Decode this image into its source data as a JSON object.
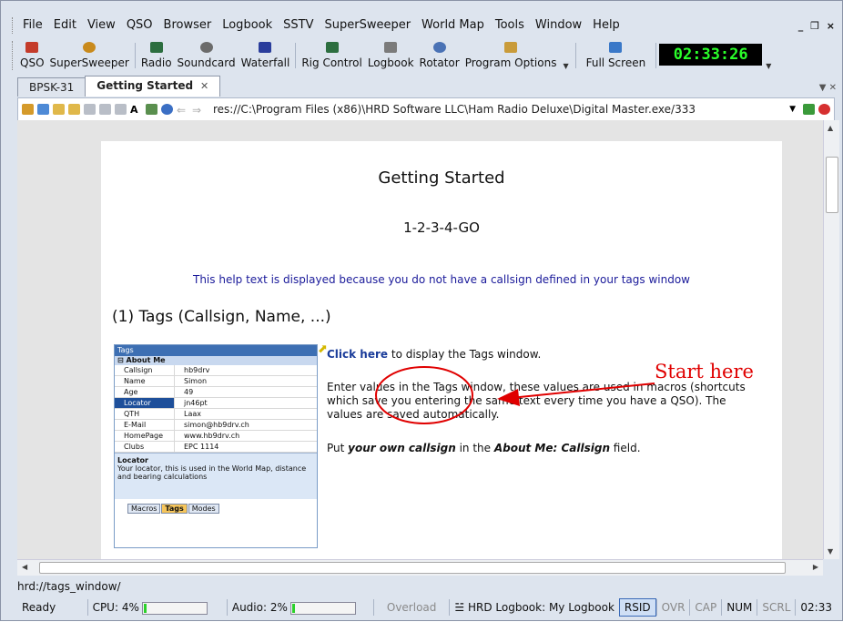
{
  "menu": [
    "File",
    "Edit",
    "View",
    "QSO",
    "Browser",
    "Logbook",
    "SSTV",
    "SuperSweeper",
    "World Map",
    "Tools",
    "Window",
    "Help"
  ],
  "window_controls": "_ ❒ ×",
  "toolbar": {
    "buttons": [
      {
        "label": "QSO",
        "icon": "qso-icon",
        "color": "#c43b2a"
      },
      {
        "label": "SuperSweeper",
        "icon": "supersweeper-icon",
        "color": "#c98a1c"
      },
      {
        "label": "Radio",
        "icon": "radio-icon",
        "color": "#2c6e3f"
      },
      {
        "label": "Soundcard",
        "icon": "soundcard-icon",
        "color": "#6b6b6b"
      },
      {
        "label": "Waterfall",
        "icon": "waterfall-icon",
        "color": "#2a3d9c"
      },
      {
        "label": "Rig Control",
        "icon": "rig-control-icon",
        "color": "#2c6e3f"
      },
      {
        "label": "Logbook",
        "icon": "logbook-icon",
        "color": "#7b7b7b"
      },
      {
        "label": "Rotator",
        "icon": "rotator-icon",
        "color": "#4a72b5"
      },
      {
        "label": "Program Options",
        "icon": "program-options-icon",
        "color": "#c99b3a"
      }
    ],
    "full_screen": "Full Screen",
    "clock": "02:33:26"
  },
  "tabs": [
    {
      "label": "BPSK-31",
      "active": false
    },
    {
      "label": "Getting Started",
      "active": true
    }
  ],
  "address": "res://C:\\Program Files (x86)\\HRD Software LLC\\Ham Radio Deluxe\\Digital Master.exe/333",
  "page": {
    "title": "Getting Started",
    "subtitle": "1-2-3-4-GO",
    "note": "This help text is displayed because you do not have a callsign defined in your tags window",
    "section": "(1) Tags (Callsign, Name, ...)",
    "click_here": "Click here",
    "click_rest": " to display the Tags window.",
    "para2": "Enter values in the Tags window, these values are used in macros (shortcuts which save you entering the same text every time you have a QSO). The values are saved automatically.",
    "para3_a": "Put ",
    "para3_b": "your own callsign",
    "para3_c": " in the ",
    "para3_d": "About Me: Callsign",
    "para3_e": " field."
  },
  "tags_window": {
    "title": "Tags",
    "group": "About Me",
    "rows": [
      {
        "k": "Callsign",
        "v": "hb9drv"
      },
      {
        "k": "Name",
        "v": "Simon"
      },
      {
        "k": "Age",
        "v": "49"
      },
      {
        "k": "Locator",
        "v": "jn46pt"
      },
      {
        "k": "QTH",
        "v": "Laax"
      },
      {
        "k": "E-Mail",
        "v": "simon@hb9drv.ch"
      },
      {
        "k": "HomePage",
        "v": "www.hb9drv.ch"
      },
      {
        "k": "Clubs",
        "v": "EPC 1114"
      }
    ],
    "desc_title": "Locator",
    "desc": "Your locator, this is used in the World Map, distance and bearing calculations",
    "tabs": [
      "Macros",
      "Tags",
      "Modes"
    ]
  },
  "annotation": "Start here",
  "hover_url": "hrd://tags_window/",
  "status": {
    "ready": "Ready",
    "cpu": "CPU: 4%",
    "cpu_level": 0.04,
    "audio": "Audio: 2%",
    "audio_level": 0.02,
    "overload": "Overload",
    "logbook": "HRD Logbook: My Logbook",
    "indicators": [
      {
        "label": "RSID",
        "on": true
      },
      {
        "label": "OVR",
        "on": false
      },
      {
        "label": "CAP",
        "on": false
      },
      {
        "label": "NUM",
        "on": true
      },
      {
        "label": "SCRL",
        "on": false
      }
    ],
    "time": "02:33"
  }
}
